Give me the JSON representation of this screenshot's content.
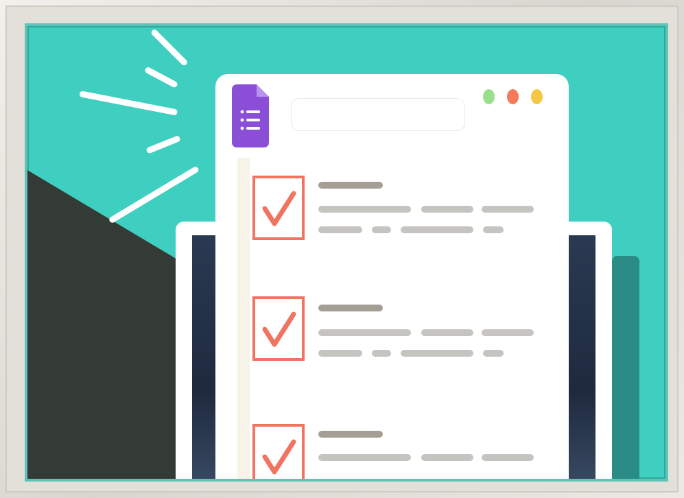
{
  "colors": {
    "teal_background": "#3ecfc0",
    "dark_background": "#343b36",
    "checkbox_orange": "#f07460",
    "forms_purple": "#8a4fd6",
    "dot_green": "#9ae08a",
    "dot_red": "#f47a5a",
    "dot_yellow": "#f5c843"
  },
  "icons": {
    "forms": "google-forms-icon",
    "check": "checkmark-icon"
  },
  "illustration": {
    "form_items": [
      {
        "checked": true
      },
      {
        "checked": true
      },
      {
        "checked": true
      }
    ]
  }
}
